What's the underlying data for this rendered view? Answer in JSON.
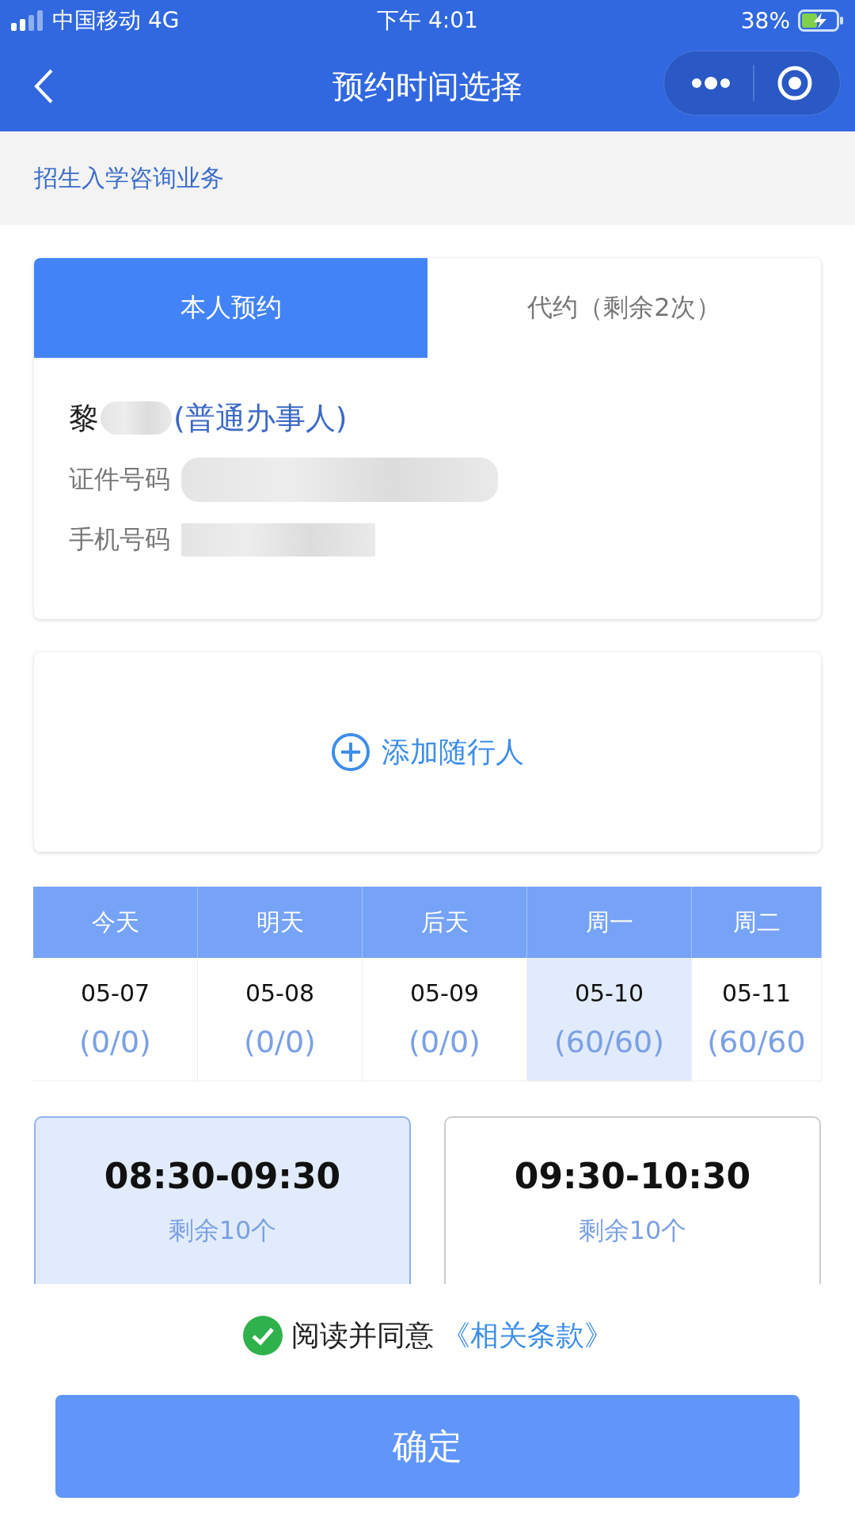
{
  "status_bar": {
    "carrier": "中国移动 4G",
    "time": "下午 4:01",
    "battery": "38%"
  },
  "nav": {
    "title": "预约时间选择"
  },
  "service": "招生入学咨询业务",
  "tabs": [
    {
      "label": "本人预约",
      "selected": true
    },
    {
      "label": "代约（剩余2次）",
      "selected": false
    }
  ],
  "person": {
    "surname": "黎",
    "role": "(普通办事人)",
    "fields": [
      {
        "label": "证件号码"
      },
      {
        "label": "手机号码"
      }
    ]
  },
  "add_companion": "添加随行人",
  "dates": [
    {
      "day": "今天",
      "date": "05-07",
      "count": "(0/0)",
      "selected": false
    },
    {
      "day": "明天",
      "date": "05-08",
      "count": "(0/0)",
      "selected": false
    },
    {
      "day": "后天",
      "date": "05-09",
      "count": "(0/0)",
      "selected": false
    },
    {
      "day": "周一",
      "date": "05-10",
      "count": "(60/60)",
      "selected": true
    },
    {
      "day": "周二",
      "date": "05-11",
      "count": "(60/60",
      "selected": false
    }
  ],
  "slots": [
    {
      "time": "08:30-09:30",
      "remaining": "剩余10个",
      "selected": true
    },
    {
      "time": "09:30-10:30",
      "remaining": "剩余10个",
      "selected": false
    }
  ],
  "agreement": {
    "checked": true,
    "text": "阅读并同意",
    "link": "《相关条款》"
  },
  "confirm": "确定"
}
